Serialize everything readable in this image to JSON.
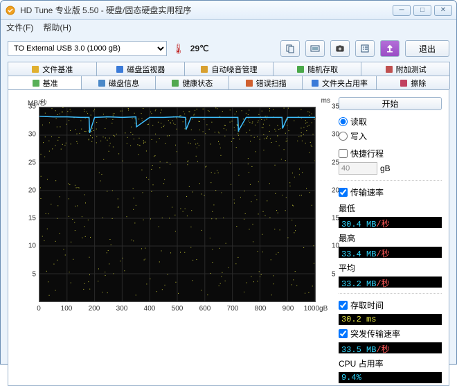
{
  "window": {
    "title": "HD Tune 专业版 5.50 - 硬盘/固态硬盘实用程序"
  },
  "menu": {
    "file": "文件(F)",
    "help": "帮助(H)"
  },
  "toolbar": {
    "device": "TO External USB 3.0 (1000 gB)",
    "temperature": "29℃",
    "exit": "退出"
  },
  "tabs_row1": [
    {
      "label": "文件基准",
      "icon": "#e0b030"
    },
    {
      "label": "磁盘监视器",
      "icon": "#3a7ad8"
    },
    {
      "label": "自动噪音管理",
      "icon": "#d8a030"
    },
    {
      "label": "随机存取",
      "icon": "#4aa84a"
    },
    {
      "label": "附加测试",
      "icon": "#c05050"
    }
  ],
  "tabs_row2": [
    {
      "label": "基准",
      "icon": "#58b058",
      "active": true
    },
    {
      "label": "磁盘信息",
      "icon": "#4a88c8"
    },
    {
      "label": "健康状态",
      "icon": "#50a850"
    },
    {
      "label": "错误扫描",
      "icon": "#d06030"
    },
    {
      "label": "文件夹占用率",
      "icon": "#3a7ad8"
    },
    {
      "label": "擦除",
      "icon": "#c04060"
    }
  ],
  "chart": {
    "y_left_label": "MB/秒",
    "y_right_label": "ms",
    "y_left_ticks": [
      "35",
      "30",
      "25",
      "20",
      "15",
      "10",
      "5"
    ],
    "y_right_ticks": [
      "35",
      "30",
      "25",
      "20",
      "15",
      "10",
      "5"
    ],
    "x_ticks": [
      "0",
      "100",
      "200",
      "300",
      "400",
      "500",
      "600",
      "700",
      "800",
      "900",
      "1000gB"
    ]
  },
  "right": {
    "start": "开始",
    "read": "读取",
    "write": "写入",
    "short_stroke": "快捷行程",
    "short_stroke_value": "40",
    "short_stroke_unit": "gB",
    "transfer_rate": "传输速率",
    "min_label": "最低",
    "min_value": "30.4 MB/秒",
    "max_label": "最高",
    "max_value": "33.4 MB/秒",
    "avg_label": "平均",
    "avg_value": "33.2 MB/秒",
    "access_time": "存取时间",
    "access_value": "30.2 ms",
    "burst_rate": "突发传输速率",
    "burst_value": "33.5 MB/秒",
    "cpu_label": "CPU 占用率",
    "cpu_value": "9.4%"
  },
  "chart_data": {
    "type": "line",
    "title": "",
    "xlabel": "gB",
    "ylabel": "MB/秒",
    "xlim": [
      0,
      1000
    ],
    "ylim_left": [
      0,
      35
    ],
    "ylim_right": [
      0,
      35
    ],
    "series": [
      {
        "name": "传输速率",
        "unit": "MB/秒",
        "axis": "left",
        "x": [
          0,
          50,
          100,
          150,
          180,
          182,
          200,
          250,
          300,
          350,
          352,
          400,
          450,
          500,
          530,
          532,
          550,
          600,
          650,
          700,
          720,
          722,
          750,
          800,
          850,
          880,
          882,
          900,
          950,
          1000
        ],
        "y": [
          33.4,
          33.3,
          33.3,
          33.2,
          33.2,
          30.4,
          33.2,
          33.3,
          33.2,
          33.3,
          31.5,
          33.2,
          33.2,
          33.3,
          33.2,
          31.0,
          33.2,
          33.2,
          33.2,
          33.2,
          33.2,
          30.8,
          33.2,
          33.2,
          33.2,
          33.2,
          31.2,
          33.2,
          33.2,
          33.2
        ]
      },
      {
        "name": "存取时间",
        "unit": "ms",
        "axis": "right",
        "type": "scatter_random",
        "mean": 30.2,
        "range": [
          1,
          35
        ]
      }
    ]
  }
}
